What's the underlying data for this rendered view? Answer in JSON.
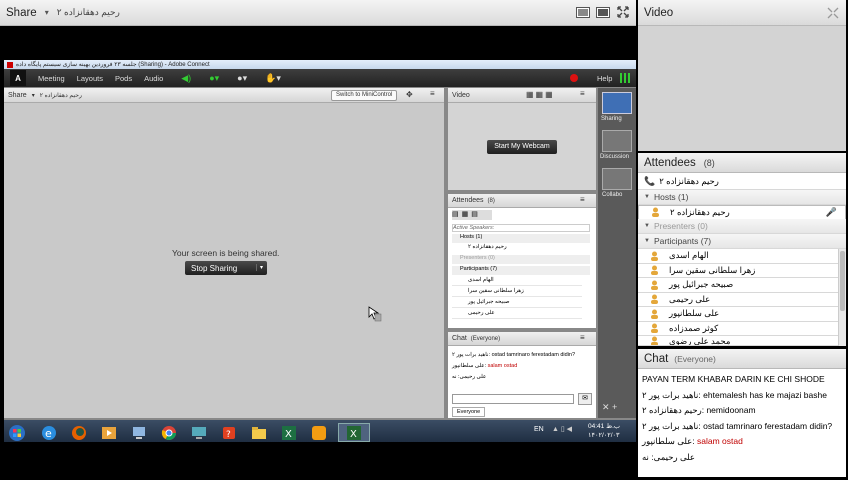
{
  "outer": {
    "share_pod": {
      "title": "Share",
      "presenter": "رحیم دهقانزاده ۲"
    },
    "video_pod": {
      "title": "Video"
    },
    "attendees_pod": {
      "title": "Attendees",
      "count": "(8)",
      "speaker": "رحیم دهقانزاده ۲",
      "hosts_label": "Hosts (1)",
      "host": "رحیم دهقانزاده ۲",
      "presenters_label": "Presenters (0)",
      "participants_label": "Participants (7)",
      "participants": [
        "الهام اسدی",
        "زهرا سلطانی سقین سرا",
        "صبیحه جبرائیل پور",
        "علی رحیمی",
        "علی سلطانپور",
        "کوثر صمدزاده",
        "محمد علی رضوی"
      ]
    },
    "chat_pod": {
      "title": "Chat",
      "scope": "(Everyone)",
      "messages": [
        {
          "author": "",
          "text": "PAYAN TERM KHABAR DARIN KE CHI SHODE",
          "red": false
        },
        {
          "author": "ناهید برات پور ۲:",
          "text": "ehtemalesh has ke majazi bashe",
          "red": false
        },
        {
          "author": "رحیم دهقانزاده ۲:",
          "text": "nemidoonam",
          "red": false
        },
        {
          "author": "ناهید برات پور ۲:",
          "text": "ostad tamrinaro ferestadam didin?",
          "red": false
        },
        {
          "author": "علی سلطانپور:",
          "text": "salam ostad",
          "red": true
        },
        {
          "author": "علی رحیمی:",
          "text": "نه",
          "red": false
        }
      ]
    }
  },
  "inner": {
    "window_title": "جلسه ۲۳ فروردین بهینه سازی سیستم پایگاه داده (Sharing) - Adobe Connect",
    "menu": [
      "Meeting",
      "Layouts",
      "Pods",
      "Audio"
    ],
    "help": "Help",
    "share_title": "Share",
    "share_presenter": "رحیم دهقانزاده ۲",
    "mini_control": "Switch to MiniControl",
    "sharing_text": "Your screen is being shared.",
    "stop_sharing": "Stop Sharing",
    "video_title": "Video",
    "start_webcam": "Start My Webcam",
    "layouts": [
      "Sharing",
      "Discussion",
      "Collabo"
    ],
    "attendees_title": "Attendees",
    "attendees_count": "(8)",
    "active_speakers": "Active Speakers:",
    "hosts_label": "Hosts (1)",
    "host": "رحیم دهقانزاده ۲",
    "presenters_label": "Presenters (0)",
    "participants_label": "Participants (7)",
    "participants": [
      "الهام اسدی",
      "زهرا سلطانی سقین سرا",
      "صبیحه جبرائیل پور",
      "علی رحیمی"
    ],
    "chat_title": "Chat",
    "chat_scope": "(Everyone)",
    "chat_messages": [
      {
        "author": "ناهید برات پور ۲:",
        "text": "ostad tamrinaro ferestadam didin?",
        "red": false
      },
      {
        "author": "علی سلطانپور:",
        "text": "salam ostad",
        "red": true
      },
      {
        "author": "علی رحیمی:",
        "text": "نه",
        "red": false
      }
    ],
    "chat_tab": "Everyone"
  },
  "taskbar": {
    "lang": "EN",
    "time": "04:41 ب.ظ",
    "date": "۱۴۰۲/۰۲/۰۳"
  },
  "colors": {
    "pod_gray": "#cfcfcf",
    "menu_bar": "#2b2b2b",
    "host_row": "#ffffff",
    "accent_red": "#c00000"
  }
}
